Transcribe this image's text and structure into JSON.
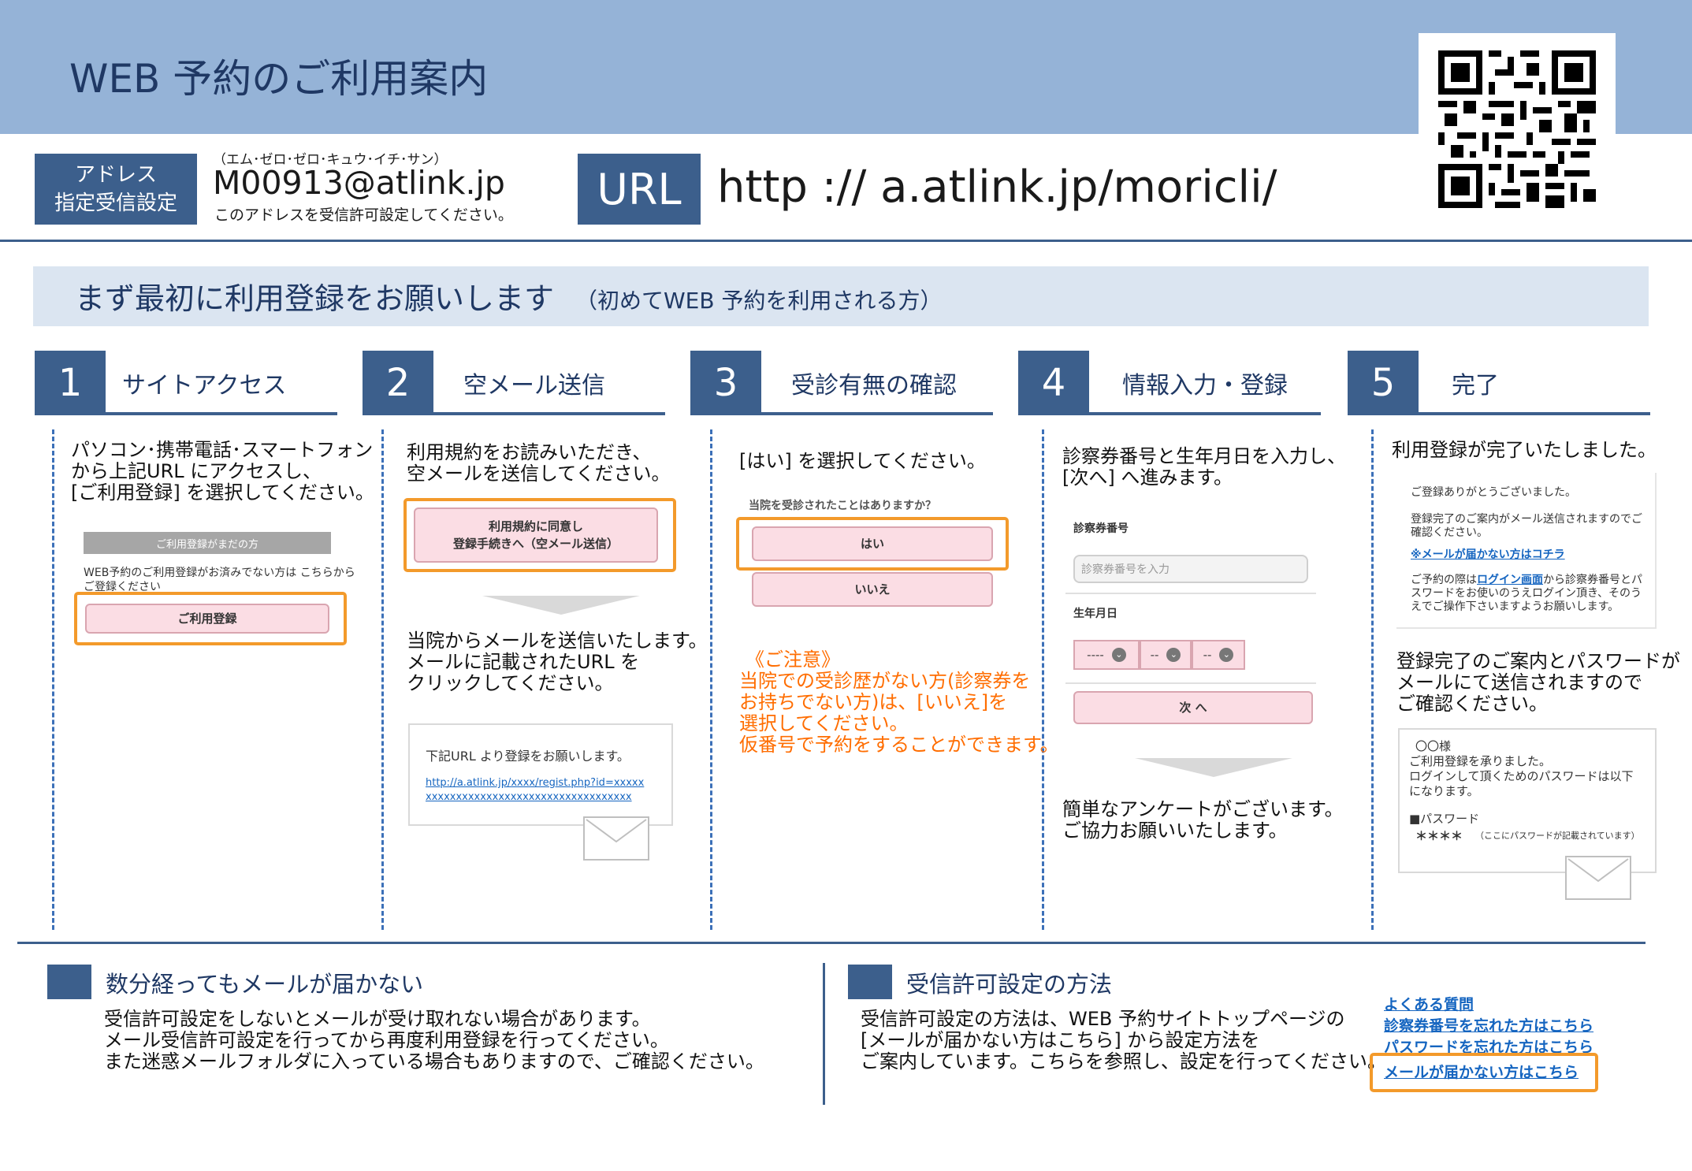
{
  "header": {
    "title": "WEB  予約のご利用案内",
    "address_badge_line1": "アドレス",
    "address_badge_line2": "指定受信設定",
    "address_kana": "（エム･ゼロ･ゼロ･キュウ･イチ･サン）",
    "address_email": "M00913@atlink.jp",
    "address_note": "このアドレスを受信許可設定してください。",
    "url_badge": "URL",
    "url_text": "http ://   a.atlink.jp/moricli/"
  },
  "banner": {
    "main": "まず最初に利用登録をお願いします",
    "sub": "（初めてWEB  予約を利用される方）"
  },
  "steps": [
    {
      "number": "1",
      "title": "サイトアクセス",
      "text": [
        "パソコン･携帯電話･スマートフォン",
        "から上記URL にアクセスし、",
        "[ご利用登録] を選択してください。"
      ],
      "mock_header": "ご利用登録がまだの方",
      "mock_text1": "WEB予約のご利用登録がお済みでない方は こちらから",
      "mock_text2": "ご登録ください",
      "mock_button": "ご利用登録"
    },
    {
      "number": "2",
      "title": "空メール送信",
      "text": [
        "利用規約をお読みいただき、",
        "空メールを送信してください。"
      ],
      "button_line1": "利用規約に同意し",
      "button_line2": "登録手続きへ（空メール送信）",
      "text2": [
        "当院からメールを送信いたします。",
        "メールに記載されたURL を",
        "クリックしてください。"
      ],
      "mail_text": "下記URL より登録をお願いします。",
      "mail_link1": "http://a.atlink.jp/xxxx/regist.php?id=xxxxx",
      "mail_link2": "xxxxxxxxxxxxxxxxxxxxxxxxxxxxxxxxxx"
    },
    {
      "number": "3",
      "title": "受診有無の確認",
      "text": [
        "[はい] を選択してください。"
      ],
      "question": "当院を受診されたことはありますか？",
      "yes": "はい",
      "no": "いいえ",
      "caution_title": "《ご注意》",
      "caution": [
        "当院での受診歴がない方(診察券を",
        "お持ちでない方)は、[いいえ]を",
        "選択してください。",
        "仮番号で予約をすることができます。"
      ]
    },
    {
      "number": "4",
      "title": "情報入力・登録",
      "text": [
        "診察券番号と生年月日を入力し、",
        "[次へ] へ進みます。"
      ],
      "label_card": "診察券番号",
      "placeholder_card": "診察券番号を入力",
      "label_birth": "生年月日",
      "sel1": "----",
      "sel2": "--",
      "sel3": "--",
      "next_button": "次 へ",
      "text2": [
        "簡単なアンケートがございます。",
        "ご協力お願いいたします。"
      ]
    },
    {
      "number": "5",
      "title": "完了",
      "text": [
        "利用登録が完了いたしました。"
      ],
      "card1_line1": "ご登録ありがとうございました。",
      "card1_line2": "登録完了のご案内がメール送信されますのでご",
      "card1_line3": "確認ください。",
      "card1_link": "※メールが届かない方はコチラ",
      "card1_line4a": "ご予約の際は",
      "card1_link2": "ログイン画面",
      "card1_line4b": "から診察券番号とパ",
      "card1_line5": "スワードをお使いのうえログイン頂き、そのう",
      "card1_line6": "えでご操作下さいますようお願いします。",
      "text2": [
        "登録完了のご案内とパスワードが",
        "メールにて送信されますので",
        "ご確認ください。"
      ],
      "card2_line1": "〇〇様",
      "card2_line2": "ご利用登録を承りました。",
      "card2_line3": "ログインして頂くためのパスワードは以下",
      "card2_line4": "になります。",
      "card2_line5": "■パスワード",
      "card2_line6": "＊＊＊＊",
      "card2_note": "（ここにパスワードが記載されています）"
    }
  ],
  "bottom_left": {
    "title": "数分経ってもメールが届かない",
    "text": [
      "受信許可設定をしないとメールが受け取れない場合があります。",
      "メール受信許可設定を行ってから再度利用登録を行ってください。",
      "また迷惑メールフォルダに入っている場合もありますので、ご確認ください。"
    ]
  },
  "bottom_right": {
    "title": "受信許可設定の方法",
    "text": [
      "受信許可設定の方法は、WEB 予約サイトトップページの",
      "[メールが届かない方はこちら] から設定方法を",
      "ご案内しています。こちらを参照し、設定を行ってください。"
    ],
    "links": [
      "よくある質問",
      "診察券番号を忘れた方はこちら",
      "パスワードを忘れた方はこちら",
      "メールが届かない方はこちら"
    ]
  },
  "colors": {
    "navy": "#3c5f8c",
    "header_blue": "#95b3d7",
    "banner_light": "#dbe5f1",
    "accent_orange": "#f39a2b",
    "caution_orange": "#ff6d00",
    "button_pink": "#fbdde4"
  },
  "icons": [
    "qr-code-icon",
    "envelope-icon",
    "chevron-down-icon",
    "down-arrow-icon"
  ]
}
